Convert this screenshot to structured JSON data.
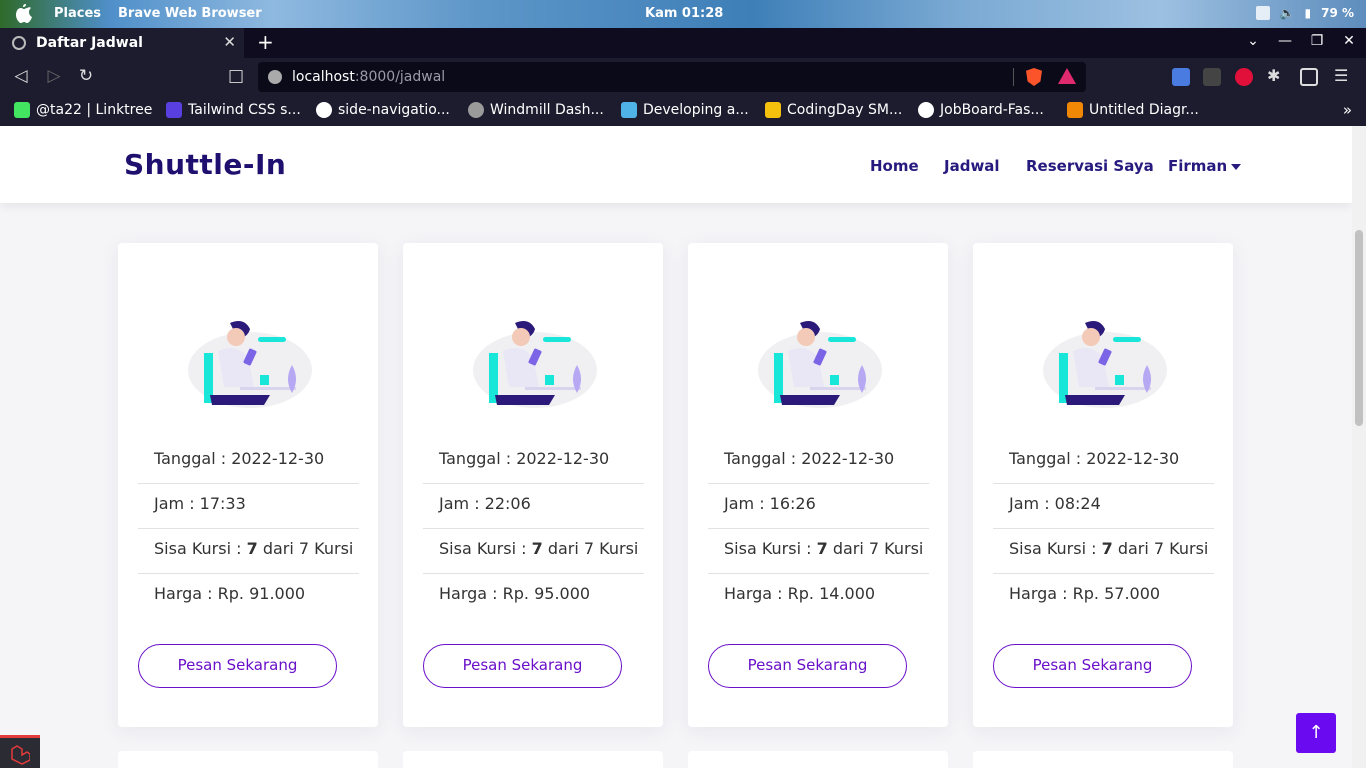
{
  "os": {
    "places": "Places",
    "app_name": "Brave Web Browser",
    "clock": "Kam 01:28",
    "battery": "79 %"
  },
  "browser": {
    "tab_title": "Daftar Jadwal",
    "url_host": "localhost",
    "url_path": ":8000/jadwal",
    "bookmarks": [
      {
        "label": "@ta22 | Linktree",
        "color": "#43e660"
      },
      {
        "label": "Tailwind CSS s...",
        "color": "#5a3fe0"
      },
      {
        "label": "side-navigatio...",
        "color": "#ffffff"
      },
      {
        "label": "Windmill Dash...",
        "color": "#9a9a9a"
      },
      {
        "label": "Developing a...",
        "color": "#4fb3e8"
      },
      {
        "label": "CodingDay SM...",
        "color": "#f4c20d"
      },
      {
        "label": "JobBoard-Fas...",
        "color": "#ffffff"
      },
      {
        "label": "Untitled Diagr...",
        "color": "#f08705"
      }
    ]
  },
  "site": {
    "brand": "Shuttle-In",
    "nav": {
      "home": "Home",
      "jadwal": "Jadwal",
      "reservasi": "Reservasi Saya",
      "user": "Firman"
    },
    "accent_color": "#6a10c8",
    "cards": [
      {
        "tanggal": "Tanggal : 2022-12-30",
        "jam": "Jam : 17:33",
        "kursi_prefix": "Sisa Kursi : ",
        "kursi_value": "7",
        "kursi_suffix": " dari 7 Kursi",
        "harga": "Harga : Rp. 91.000",
        "button": "Pesan Sekarang"
      },
      {
        "tanggal": "Tanggal : 2022-12-30",
        "jam": "Jam : 22:06",
        "kursi_prefix": "Sisa Kursi : ",
        "kursi_value": "7",
        "kursi_suffix": " dari 7 Kursi",
        "harga": "Harga : Rp. 95.000",
        "button": "Pesan Sekarang"
      },
      {
        "tanggal": "Tanggal : 2022-12-30",
        "jam": "Jam : 16:26",
        "kursi_prefix": "Sisa Kursi : ",
        "kursi_value": "7",
        "kursi_suffix": " dari 7 Kursi",
        "harga": "Harga : Rp. 14.000",
        "button": "Pesan Sekarang"
      },
      {
        "tanggal": "Tanggal : 2022-12-30",
        "jam": "Jam : 08:24",
        "kursi_prefix": "Sisa Kursi : ",
        "kursi_value": "7",
        "kursi_suffix": " dari 7 Kursi",
        "harga": "Harga : Rp. 57.000",
        "button": "Pesan Sekarang"
      }
    ],
    "scroll_top_icon": "arrow-up-icon"
  }
}
